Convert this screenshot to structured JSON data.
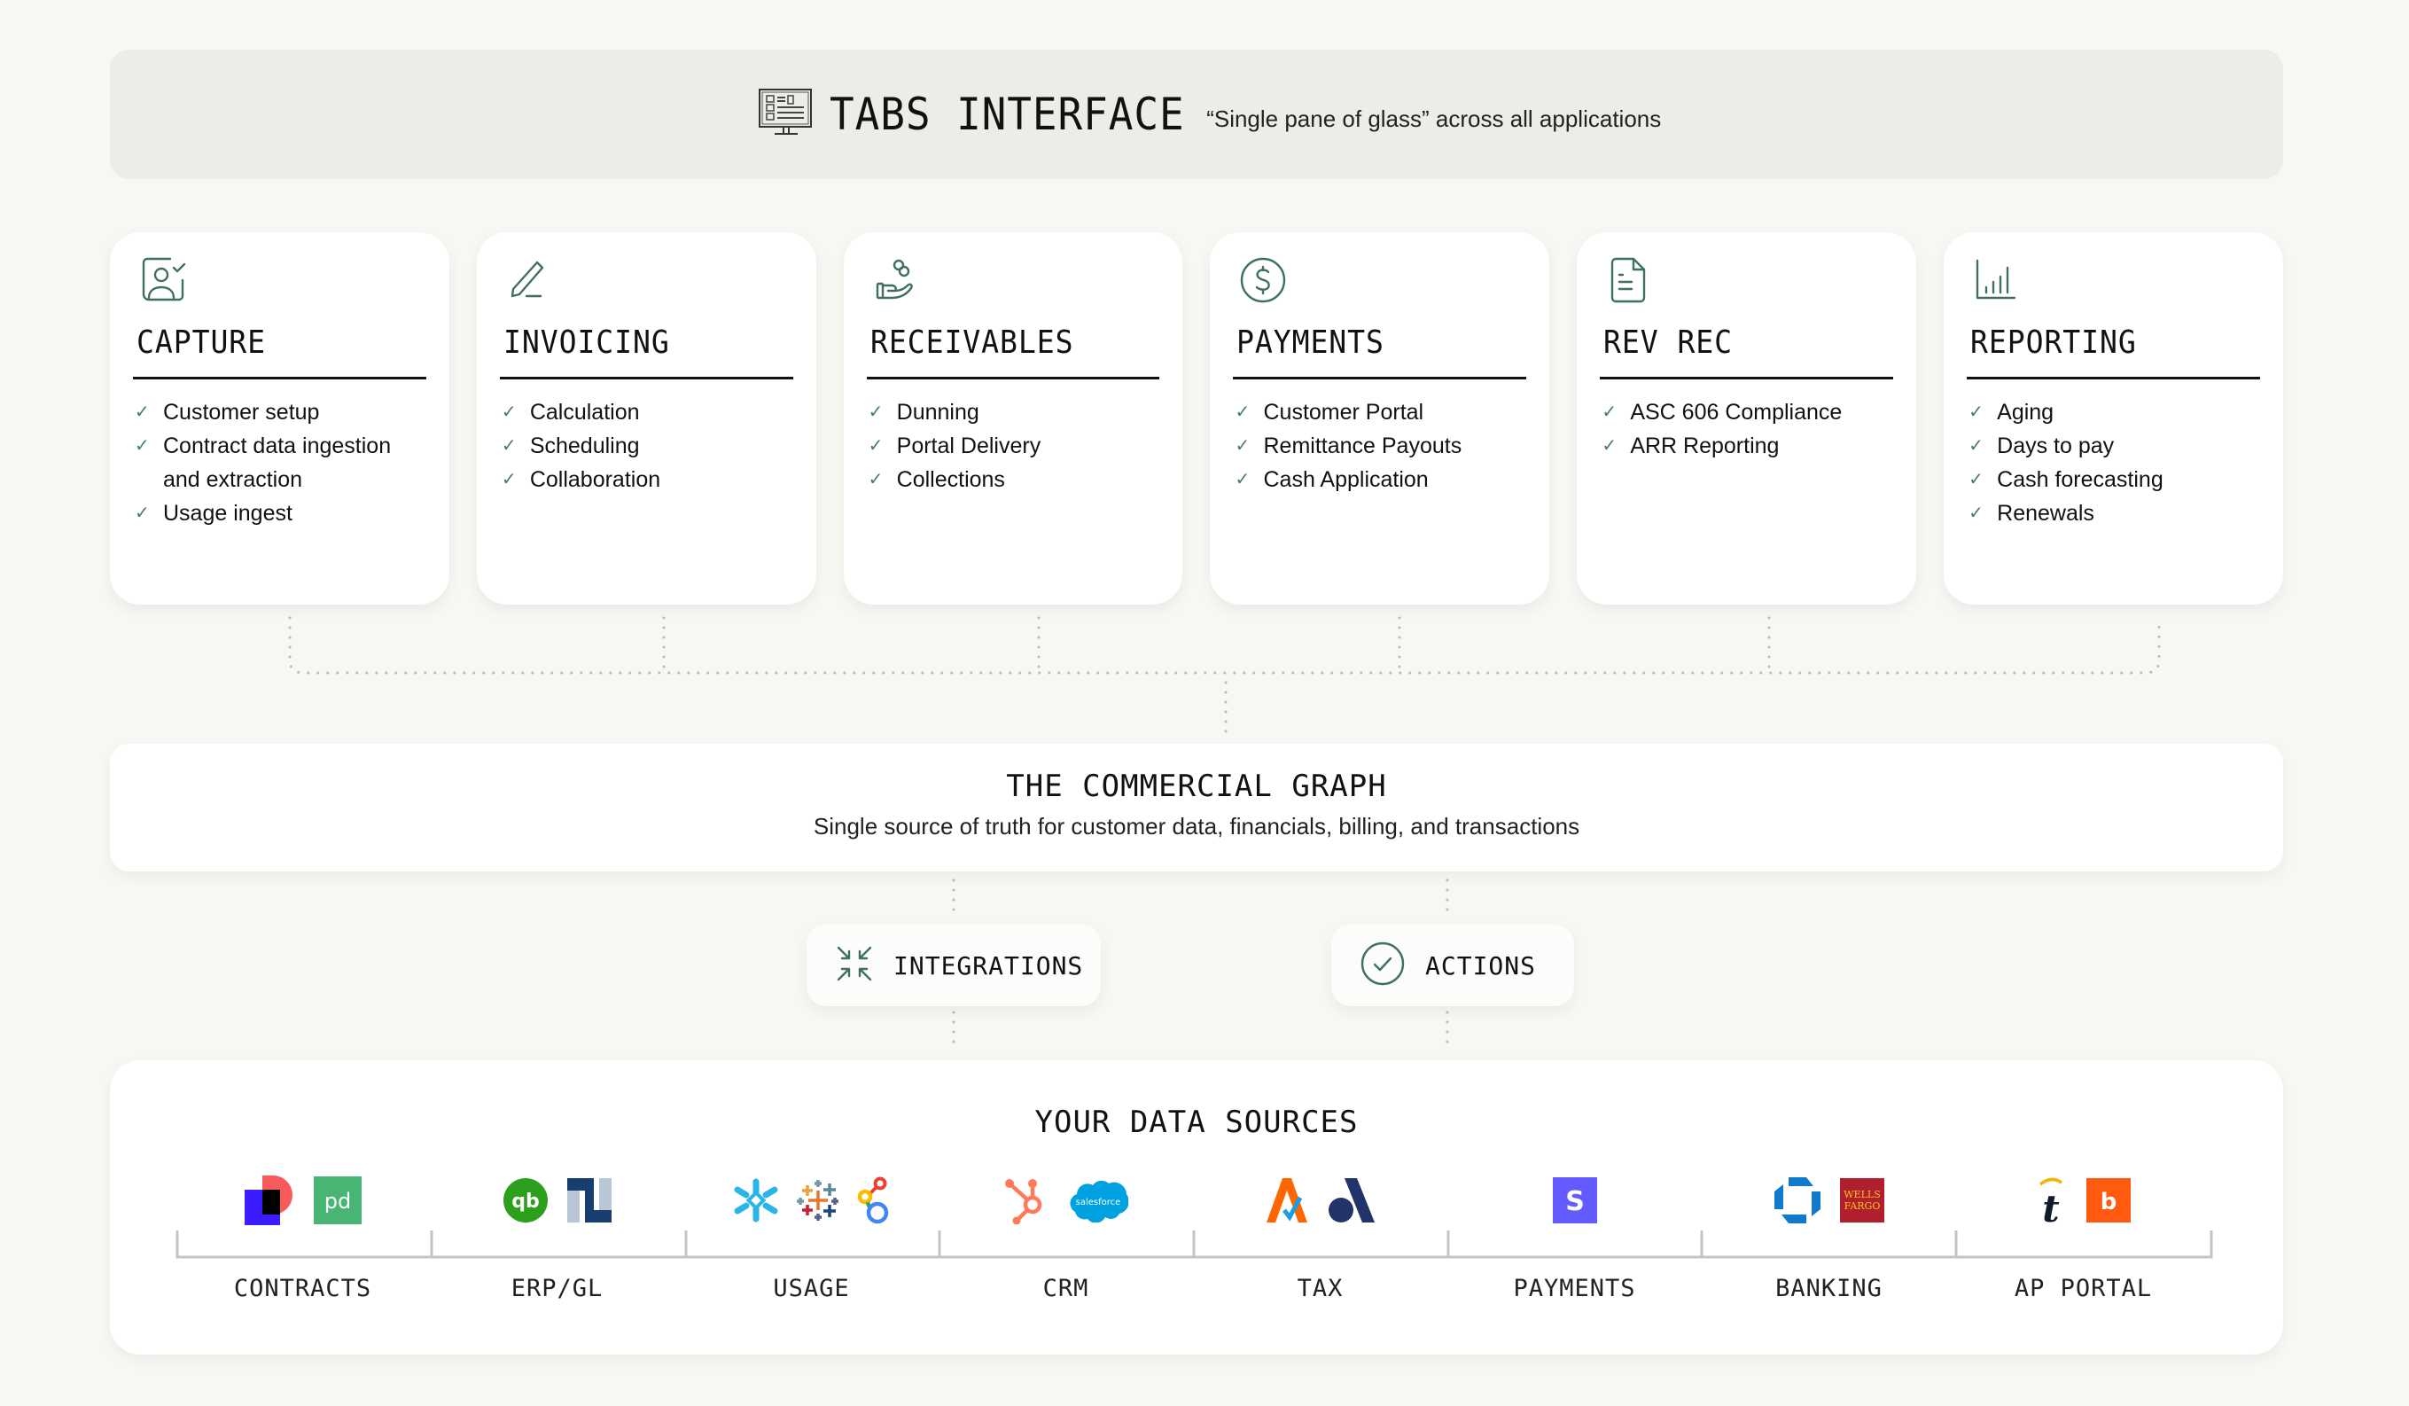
{
  "banner": {
    "icon": "monitor-dashboard-icon",
    "title": "TABS INTERFACE",
    "subtitle": "“Single pane of glass” across all applications"
  },
  "modules": [
    {
      "icon": "user-check-icon",
      "title": "CAPTURE",
      "items": [
        "Customer setup",
        "Contract data ingestion and extraction",
        "Usage ingest"
      ]
    },
    {
      "icon": "pen-icon",
      "title": "INVOICING",
      "items": [
        "Calculation",
        "Scheduling",
        "Collaboration"
      ]
    },
    {
      "icon": "hand-coins-icon",
      "title": "RECEIVABLES",
      "items": [
        "Dunning",
        "Portal Delivery",
        "Collections"
      ]
    },
    {
      "icon": "dollar-circle-icon",
      "title": "PAYMENTS",
      "items": [
        "Customer Portal",
        "Remittance Payouts",
        "Cash Application"
      ]
    },
    {
      "icon": "document-icon",
      "title": "REV REC",
      "items": [
        "ASC 606 Compliance",
        "ARR Reporting"
      ]
    },
    {
      "icon": "bar-chart-icon",
      "title": "REPORTING",
      "items": [
        "Aging",
        "Days to pay",
        "Cash forecasting",
        "Renewals"
      ]
    }
  ],
  "check_icon": "✓",
  "graph": {
    "title": "THE COMMERCIAL GRAPH",
    "subtitle": "Single source of truth for customer data, financials, billing, and transactions"
  },
  "pills": {
    "integrations": {
      "icon": "arrows-inward-icon",
      "label": "INTEGRATIONS"
    },
    "actions": {
      "icon": "check-circle-icon",
      "label": "ACTIONS"
    }
  },
  "sources": {
    "title": "YOUR DATA SOURCES",
    "categories": [
      {
        "label": "CONTRACTS",
        "logos": [
          "dropbox-sign-logo",
          "pandadoc-logo"
        ]
      },
      {
        "label": "ERP/GL",
        "logos": [
          "quickbooks-logo",
          "netsuite-logo"
        ]
      },
      {
        "label": "USAGE",
        "logos": [
          "snowflake-logo",
          "tableau-logo",
          "looker-logo"
        ]
      },
      {
        "label": "CRM",
        "logos": [
          "hubspot-logo",
          "salesforce-logo"
        ]
      },
      {
        "label": "TAX",
        "logos": [
          "avalara-logo",
          "anrok-logo"
        ]
      },
      {
        "label": "PAYMENTS",
        "logos": [
          "stripe-logo"
        ]
      },
      {
        "label": "BANKING",
        "logos": [
          "chase-logo",
          "wells-fargo-logo"
        ]
      },
      {
        "label": "AP PORTAL",
        "logos": [
          "tipalti-logo",
          "bill-logo"
        ]
      }
    ],
    "logo_text": {
      "salesforce": "salesforce",
      "wells_fargo_1": "WELLS",
      "wells_fargo_2": "FARGO",
      "stripe": "S",
      "pandadoc": "pd",
      "quickbooks": "qb",
      "netsuite": "N",
      "tipalti": "t",
      "bill": "b"
    }
  },
  "colors": {
    "background": "#f7f8f3",
    "banner": "#ebede6",
    "accent": "#3f6f62",
    "connector": "#b9bab5"
  }
}
